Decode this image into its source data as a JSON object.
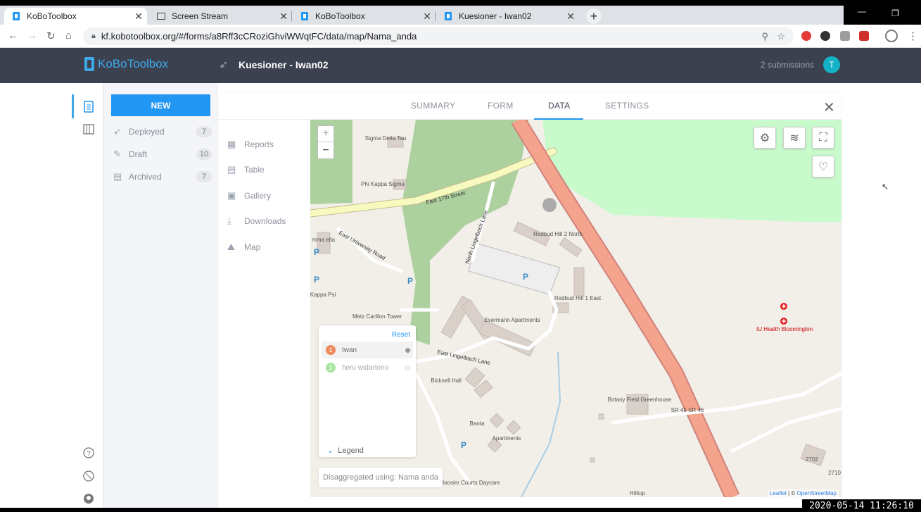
{
  "browser": {
    "tabs": [
      {
        "title": "KoBoToolbox",
        "active": true
      },
      {
        "title": "Screen Stream",
        "active": false
      },
      {
        "title": "KoBoToolbox",
        "active": false
      },
      {
        "title": "Kuesioner - Iwan02",
        "active": false
      }
    ],
    "url": "kf.kobotoolbox.org/#/forms/a8Rff3cCRoziGhviWWqtFC/data/map/Nama_anda"
  },
  "header": {
    "logo": "KoBoToolbox",
    "project_title": "Kuesioner - Iwan02",
    "submissions": "2 submissions",
    "avatar_letter": "T"
  },
  "sidebar": {
    "new_label": "NEW",
    "items": [
      {
        "label": "Deployed",
        "count": "7"
      },
      {
        "label": "Draft",
        "count": "10"
      },
      {
        "label": "Archived",
        "count": "7"
      }
    ]
  },
  "panel_tabs": {
    "summary": "SUMMARY",
    "form": "FORM",
    "data": "DATA",
    "settings": "SETTINGS"
  },
  "data_nav": [
    "Reports",
    "Table",
    "Gallery",
    "Downloads",
    "Map"
  ],
  "map": {
    "labels": {
      "sigma": "Sigma Delta Tau",
      "phikappa": "Phi Kappa Sigma",
      "e17": "East 17th Street",
      "eu": "East University Road",
      "nl": "North Lingelbach Lane",
      "redbud2": "Redbud Hill 2 North",
      "redbud1": "Redbud Hill 1 East",
      "evermann": "Evermann Apartments",
      "metz": "Metz Carillon Tower",
      "eastling": "East Lingelbach Lane",
      "bicknell": "Bicknell Hall",
      "banta": "Banta",
      "apartments": "Apartments",
      "botany": "Botany Field Greenhouse",
      "sr": "SR 45 SR 46",
      "iuhealth": "IU Health Bloomington",
      "hoosier": "Hoosier Courts Daycare",
      "hilltop": "Hilltop",
      "alpha": "lpha mma elta",
      "kappa": "Kappa Psi",
      "n2702": "2702",
      "n2710": "2710"
    },
    "legend": {
      "reset": "Reset",
      "toggle": "Legend",
      "rows": [
        {
          "num": "1",
          "name": "Iwan",
          "color": "#f08a5d"
        },
        {
          "num": "1",
          "name": "heru widartono",
          "color": "#a8e6a3"
        }
      ]
    },
    "disaggregated": "Disaggregated using: Nama anda",
    "attribution_leaflet": "Leaflet",
    "attribution_sep": " | © ",
    "attribution_osm": "OpenStreetMap"
  },
  "timestamp": "2020-05-14 11:26:10"
}
